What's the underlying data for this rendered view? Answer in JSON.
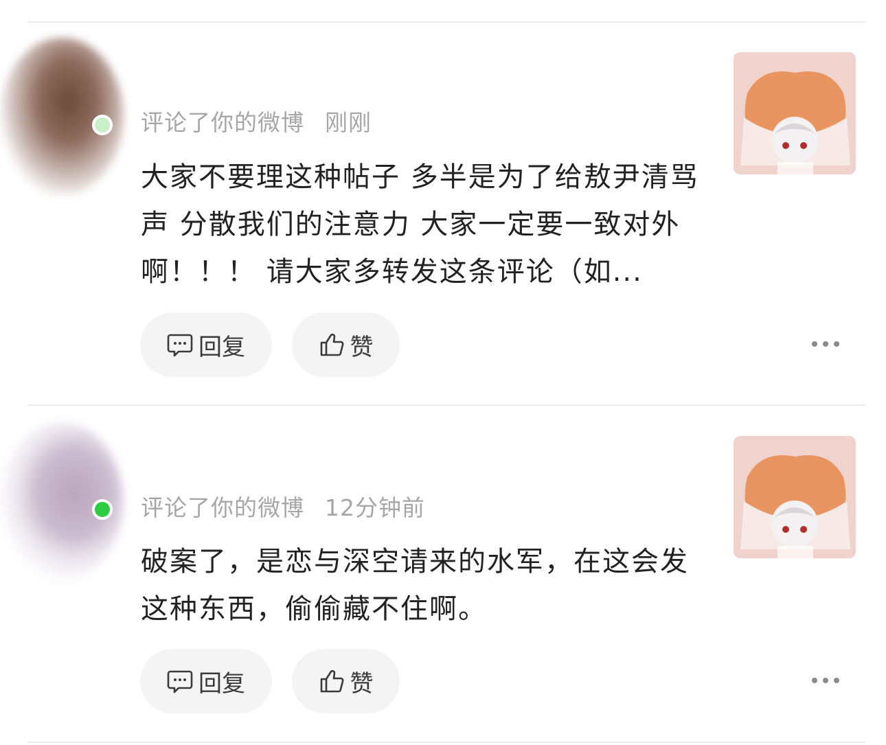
{
  "comments": [
    {
      "action_text": "评论了你的微博",
      "time": "刚刚",
      "text": "大家不要理这种帖子 多半是为了给敖尹清骂声 分散我们的注意力 大家一定要一致对外啊！！！ 请大家多转发这条评论（如...",
      "reply_label": "回复",
      "like_label": "赞",
      "avatar_color": "#7a5a4d",
      "status_color": "#c8efc8"
    },
    {
      "action_text": "评论了你的微博",
      "time": "12分钟前",
      "text": "破案了，是恋与深空请来的水军，在这会发这种东西，偷偷藏不住啊。",
      "reply_label": "回复",
      "like_label": "赞",
      "avatar_color": "#c9b8cc",
      "status_color": "#2ecc40"
    }
  ],
  "icons": {
    "reply": "comment-bubble-icon",
    "like": "thumbs-up-icon",
    "more": "more-dots-icon"
  },
  "colors": {
    "meta_gray": "#a6a6a6",
    "text_dark": "#222222",
    "pill_bg": "#f4f4f4"
  }
}
